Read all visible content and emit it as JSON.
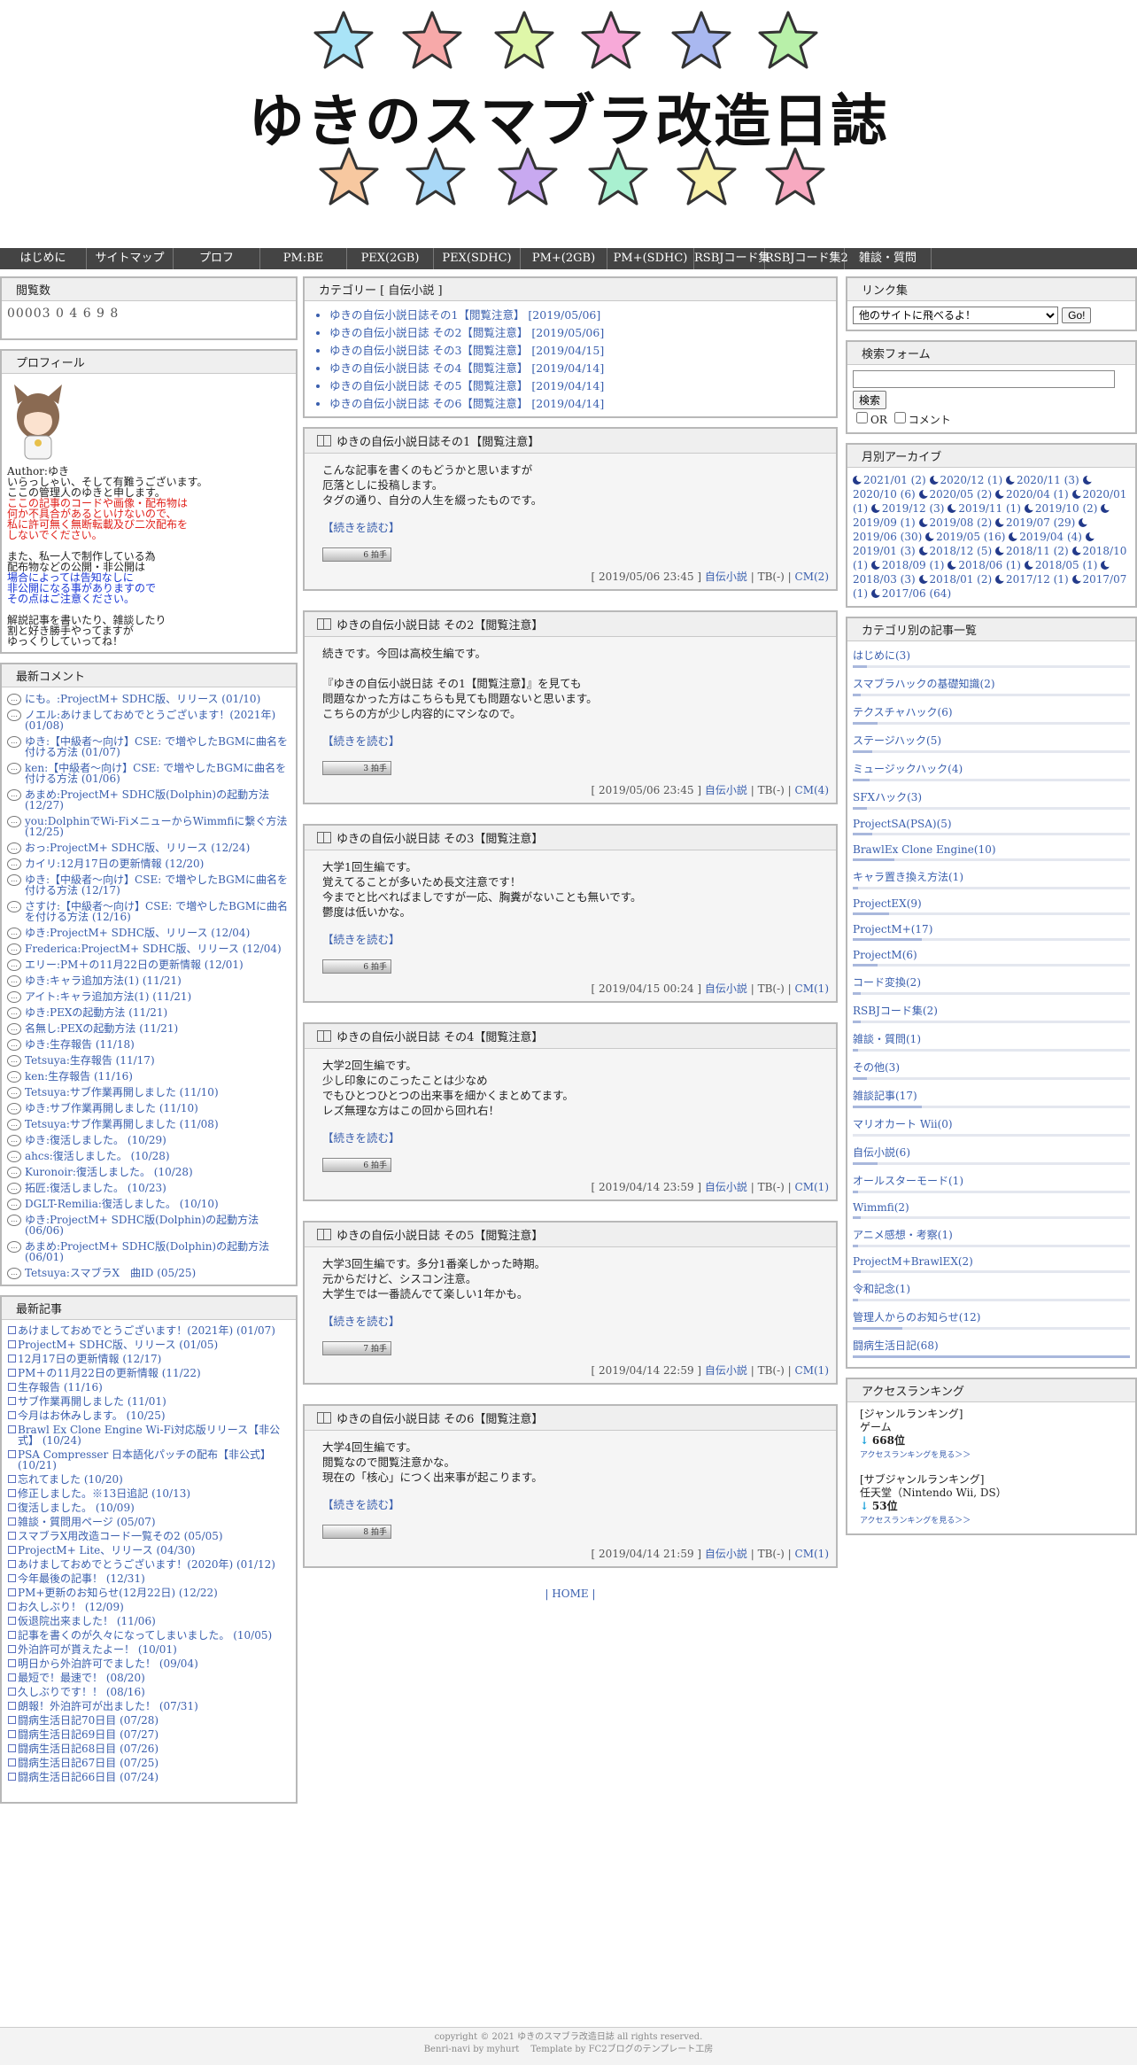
{
  "site": {
    "title": "ゆきのスマブラ改造日誌"
  },
  "nav": [
    "はじめに",
    "サイトマップ",
    "プロフ",
    "PM:BE",
    "PEX(2GB)",
    "PEX(SDHC)",
    "PM+(2GB)",
    "PM+(SDHC)",
    "RSBJコード集",
    "RSBJコード集2",
    "雑談・質問"
  ],
  "counter": {
    "title": "閲覧数",
    "value": "00003 0 4 6 9 8"
  },
  "profile": {
    "title": "プロフィール",
    "author": "Author:ゆき",
    "lines1": [
      "いらっしゃい、そして有難うございます。",
      "ここの管理人のゆきと申します。"
    ],
    "red_lines": [
      "ここの記事のコードや画像・配布物は",
      "何か不具合があるといけないので、",
      "私に許可無く無断転載及び二次配布を",
      "しないでください。"
    ],
    "lines2": [
      "また、私一人で制作している為",
      "配布物などの公開・非公開は"
    ],
    "blue_lines": [
      "場合によっては告知なしに",
      "非公開になる事がありますので",
      "その点はご注意ください。"
    ],
    "lines3": [
      "解説記事を書いたり、雑談したり",
      "割と好き勝手やってますが",
      "ゆっくりしていってね！"
    ]
  },
  "recent_comments": {
    "title": "最新コメント",
    "items": [
      "にも。:ProjectM+ SDHC版、リリース (01/10)",
      "ノエル:あけましておめでとうございます！(2021年) (01/08)",
      "ゆき:【中級者～向け】CSE: で増やしたBGMに曲名を付ける方法 (01/07)",
      "ken:【中級者～向け】CSE: で増やしたBGMに曲名を付ける方法 (01/06)",
      "あまめ:ProjectM+ SDHC版(Dolphin)の起動方法 (12/27)",
      "you:DolphinでWi-FiメニューからWimmfiに繋ぐ方法 (12/25)",
      "おっ:ProjectM+ SDHC版、リリース (12/24)",
      "カイリ:12月17日の更新情報 (12/20)",
      "ゆき:【中級者～向け】CSE: で増やしたBGMに曲名を付ける方法 (12/17)",
      "さすけ:【中級者～向け】CSE: で増やしたBGMに曲名を付ける方法 (12/16)",
      "ゆき:ProjectM+ SDHC版、リリース (12/04)",
      "Frederica:ProjectM+ SDHC版、リリース (12/04)",
      "エリー:PM＋の11月22日の更新情報 (12/01)",
      "ゆき:キャラ追加方法(1) (11/21)",
      "アイト:キャラ追加方法(1) (11/21)",
      "ゆき:PEXの起動方法 (11/21)",
      "名無し:PEXの起動方法 (11/21)",
      "ゆき:生存報告 (11/18)",
      "Tetsuya:生存報告 (11/17)",
      "ken:生存報告 (11/16)",
      "Tetsuya:サブ作業再開しました (11/10)",
      "ゆき:サブ作業再開しました (11/10)",
      "Tetsuya:サブ作業再開しました (11/08)",
      "ゆき:復活しました。 (10/29)",
      "ahcs:復活しました。 (10/28)",
      "Kuronoir:復活しました。 (10/28)",
      "拓匠:復活しました。 (10/23)",
      "DGLT-Remilia:復活しました。 (10/10)",
      "ゆき:ProjectM+ SDHC版(Dolphin)の起動方法 (06/06)",
      "あまめ:ProjectM+ SDHC版(Dolphin)の起動方法 (06/01)",
      "Tetsuya:スマブラX　曲ID (05/25)"
    ]
  },
  "recent_articles": {
    "title": "最新記事",
    "items": [
      "あけましておめでとうございます！(2021年) (01/07)",
      "ProjectM+ SDHC版、リリース (01/05)",
      "12月17日の更新情報 (12/17)",
      "PM＋の11月22日の更新情報 (11/22)",
      "生存報告 (11/16)",
      "サブ作業再開しました (11/01)",
      "今月はお休みします。 (10/25)",
      "Brawl Ex Clone Engine Wi-Fi対応版リリース【非公式】 (10/24)",
      "PSA Compresser 日本語化パッチの配布【非公式】 (10/21)",
      "忘れてました (10/20)",
      "修正しました。※13日追記 (10/13)",
      "復活しました。 (10/09)",
      "雑談・質問用ページ (05/07)",
      "スマブラX用改造コード一覧その2 (05/05)",
      "ProjectM+ Lite、リリース (04/30)",
      "あけましておめでとうございます！(2020年) (01/12)",
      "今年最後の記事！ (12/31)",
      "PM+更新のお知らせ(12月22日) (12/22)",
      "お久しぶり！ (12/09)",
      "仮退院出来ました！ (11/06)",
      "記事を書くのが久々になってしまいました。 (10/05)",
      "外泊許可が貰えたよー！ (10/01)",
      "明日から外泊許可でました！ (09/04)",
      "最短で！最速で！ (08/20)",
      "久しぶりです！！ (08/16)",
      "朗報！外泊許可が出ました！ (07/31)",
      "闘病生活日記70日目 (07/28)",
      "闘病生活日記69日目 (07/27)",
      "闘病生活日記68日目 (07/26)",
      "闘病生活日記67日目 (07/25)",
      "闘病生活日記66日目 (07/24)"
    ]
  },
  "category_header": {
    "title": "カテゴリー [ 自伝小説 ]",
    "items": [
      "ゆきの自伝小説日誌その1【閲覧注意】 [2019/05/06]",
      "ゆきの自伝小説日誌 その2【閲覧注意】 [2019/05/06]",
      "ゆきの自伝小説日誌 その3【閲覧注意】 [2019/04/15]",
      "ゆきの自伝小説日誌 その4【閲覧注意】 [2019/04/14]",
      "ゆきの自伝小説日誌 その5【閲覧注意】 [2019/04/14]",
      "ゆきの自伝小説日誌 その6【閲覧注意】 [2019/04/14]"
    ]
  },
  "entries": [
    {
      "title": "ゆきの自伝小説日誌その1【閲覧注意】",
      "lines": [
        "こんな記事を書くのもどうかと思いますが",
        "厄落としに投稿します。",
        "タグの通り、自分の人生を綴ったものです。"
      ],
      "more": "【続きを読む】",
      "clap": "6 拍手",
      "date": "[ 2019/05/06 23:45 ]",
      "category": "自伝小説",
      "tb": "TB(-)",
      "cm": "CM(2)"
    },
    {
      "title": "ゆきの自伝小説日誌 その2【閲覧注意】",
      "lines": [
        "続きです。今回は高校生編です。",
        "",
        "『ゆきの自伝小説日誌 その1【閲覧注意】』を見ても",
        "問題なかった方はこちらも見ても問題ないと思います。",
        "こちらの方が少し内容的にマシなので。"
      ],
      "more": "【続きを読む】",
      "clap": "3 拍手",
      "date": "[ 2019/05/06 23:45 ]",
      "category": "自伝小説",
      "tb": "TB(-)",
      "cm": "CM(4)"
    },
    {
      "title": "ゆきの自伝小説日誌 その3【閲覧注意】",
      "lines": [
        "大学1回生編です。",
        "覚えてることが多いため長文注意です！",
        "今までと比べればましですが一応、胸糞がないことも無いです。",
        "鬱度は低いかな。"
      ],
      "more": "【続きを読む】",
      "clap": "6 拍手",
      "date": "[ 2019/04/15 00:24 ]",
      "category": "自伝小説",
      "tb": "TB(-)",
      "cm": "CM(1)"
    },
    {
      "title": "ゆきの自伝小説日誌 その4【閲覧注意】",
      "lines": [
        "大学2回生編です。",
        "少し印象にのこったことは少なめ",
        "でもひとつひとつの出来事を細かくまとめてます。",
        "レズ無理な方はこの回から回れ右！"
      ],
      "more": "【続きを読む】",
      "clap": "6 拍手",
      "date": "[ 2019/04/14 23:59 ]",
      "category": "自伝小説",
      "tb": "TB(-)",
      "cm": "CM(1)"
    },
    {
      "title": "ゆきの自伝小説日誌 その5【閲覧注意】",
      "lines": [
        "大学3回生編です。多分1番楽しかった時期。",
        "元からだけど、シスコン注意。",
        "大学生では一番読んでて楽しい1年かも。"
      ],
      "more": "【続きを読む】",
      "clap": "7 拍手",
      "date": "[ 2019/04/14 22:59 ]",
      "category": "自伝小説",
      "tb": "TB(-)",
      "cm": "CM(1)"
    },
    {
      "title": "ゆきの自伝小説日誌 その6【閲覧注意】",
      "lines": [
        "大学4回生編です。",
        "閲覧なので閲覧注意かな。",
        "現在の「核心」につく出来事が起こります。"
      ],
      "more": "【続きを読む】",
      "clap": "8 拍手",
      "date": "[ 2019/04/14 21:59 ]",
      "category": "自伝小説",
      "tb": "TB(-)",
      "cm": "CM(1)"
    }
  ],
  "pager": "| HOME |",
  "links": {
    "title": "リンク集",
    "select_value": "他のサイトに飛べるよ！",
    "go": "Go!"
  },
  "search": {
    "title": "検索フォーム",
    "button": "検索",
    "or_label": "OR",
    "comment_label": "コメント"
  },
  "archive": {
    "title": "月別アーカイブ",
    "items": [
      "2021/01 (2)",
      "2020/12 (1)",
      "2020/11 (3)",
      "2020/10 (6)",
      "2020/05 (2)",
      "2020/04 (1)",
      "2020/01 (1)",
      "2019/12 (3)",
      "2019/11 (1)",
      "2019/10 (2)",
      "2019/09 (1)",
      "2019/08 (2)",
      "2019/07 (29)",
      "2019/06 (30)",
      "2019/05 (16)",
      "2019/04 (4)",
      "2019/01 (3)",
      "2018/12 (5)",
      "2018/11 (2)",
      "2018/10 (1)",
      "2018/09 (1)",
      "2018/06 (1)",
      "2018/05 (1)",
      "2018/03 (3)",
      "2018/01 (2)",
      "2017/12 (1)",
      "2017/07 (1)",
      "2017/06 (64)"
    ]
  },
  "categories": {
    "title": "カテゴリ別の記事一覧",
    "items": [
      {
        "label": "はじめに(3)",
        "bar": 0.05
      },
      {
        "label": "スマブラハックの基礎知識(2)",
        "bar": 0.03
      },
      {
        "label": "テクスチャハック(6)",
        "bar": 0.09
      },
      {
        "label": "ステージハック(5)",
        "bar": 0.07
      },
      {
        "label": "ミュージックハック(4)",
        "bar": 0.06
      },
      {
        "label": "SFXハック(3)",
        "bar": 0.05
      },
      {
        "label": "ProjectSA(PSA)(5)",
        "bar": 0.07
      },
      {
        "label": "BrawlEx Clone Engine(10)",
        "bar": 0.15
      },
      {
        "label": "キャラ置き換え方法(1)",
        "bar": 0.02
      },
      {
        "label": "ProjectEX(9)",
        "bar": 0.13
      },
      {
        "label": "ProjectM+(17)",
        "bar": 0.25
      },
      {
        "label": "ProjectM(6)",
        "bar": 0.09
      },
      {
        "label": "コード変換(2)",
        "bar": 0.03
      },
      {
        "label": "RSBJコード集(2)",
        "bar": 0.03
      },
      {
        "label": "雑談・質問(1)",
        "bar": 0.02
      },
      {
        "label": "その他(3)",
        "bar": 0.05
      },
      {
        "label": "雑談記事(17)",
        "bar": 0.25
      },
      {
        "label": "マリオカート Wii(0)",
        "bar": 0.0
      },
      {
        "label": "自伝小説(6)",
        "bar": 0.09
      },
      {
        "label": "オールスターモード(1)",
        "bar": 0.02
      },
      {
        "label": "Wimmfi(2)",
        "bar": 0.03
      },
      {
        "label": "アニメ感想・考察(1)",
        "bar": 0.02
      },
      {
        "label": "ProjectM+BrawlEX(2)",
        "bar": 0.03
      },
      {
        "label": "令和記念(1)",
        "bar": 0.02
      },
      {
        "label": "管理人からのお知らせ(12)",
        "bar": 0.18
      },
      {
        "label": "闘病生活日記(68)",
        "bar": 1.0
      }
    ]
  },
  "ranking": {
    "title": "アクセスランキング",
    "genre_label": "[ジャンルランキング]",
    "genre": "ゲーム",
    "genre_rank": "668位",
    "link1": "アクセスランキングを見る＞＞",
    "sub_label": "[サブジャンルランキング]",
    "sub": "任天堂（Nintendo Wii, DS）",
    "sub_rank": "53位",
    "link2": "アクセスランキングを見る＞＞"
  },
  "footer": {
    "line1": "copyright © 2021 ゆきのスマブラ改造日誌 all rights reserved.",
    "line2": "Benri-navi by myhurt　 Template by FC2ブログのテンプレート工房"
  },
  "colors": {
    "star_top": [
      "#a9e4f7",
      "#f7a9a9",
      "#dff7a9",
      "#f7a9d8",
      "#a9b8f0",
      "#b8f0a9"
    ],
    "star_bottom": [
      "#f7c8a0",
      "#a9d8f7",
      "#c8a9f0",
      "#a9f0d0",
      "#f7f0a9",
      "#f7a9c0"
    ]
  }
}
